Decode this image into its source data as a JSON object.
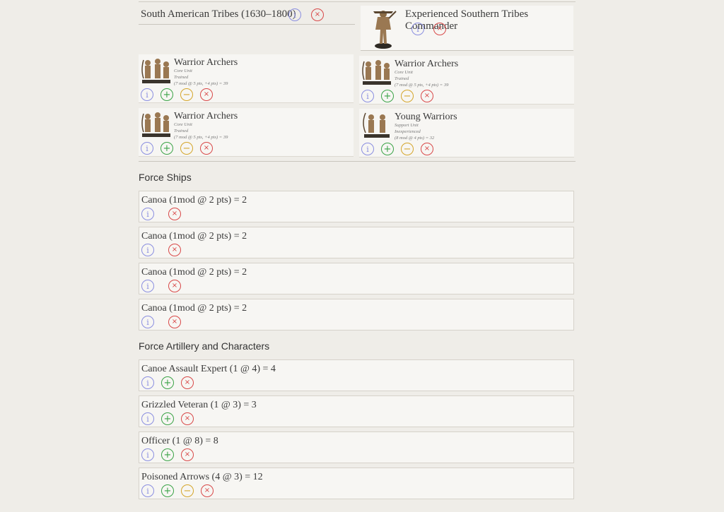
{
  "icons": {
    "info": "i",
    "add": "+",
    "remove": "−",
    "delete": "×"
  },
  "force": {
    "tribe_label": "South American Tribes (1630–1800)",
    "commander": "Experienced Southern Tribes Commander"
  },
  "units": [
    {
      "name": "Warrior Archers",
      "type": "Core Unit",
      "quality": "Trained",
      "cost": "(7 mod @ 5 pts, +4 pts) = 39"
    },
    {
      "name": "Warrior Archers",
      "type": "Core Unit",
      "quality": "Trained",
      "cost": "(7 mod @ 5 pts, +4 pts) = 39"
    },
    {
      "name": "Warrior Archers",
      "type": "Core Unit",
      "quality": "Trained",
      "cost": "(7 mod @ 5 pts, +4 pts) = 39"
    },
    {
      "name": "Young Warriors",
      "type": "Support Unit",
      "quality": "Inexperienced",
      "cost": "(8 mod @ 4 pts) = 32"
    }
  ],
  "ships": {
    "title": "Force Ships",
    "items": [
      "Canoa (1mod @ 2 pts) = 2",
      "Canoa (1mod @ 2 pts) = 2",
      "Canoa (1mod @ 2 pts) = 2",
      "Canoa (1mod @ 2 pts) = 2"
    ]
  },
  "artillery": {
    "title": "Force Artillery and Characters",
    "items": [
      "Canoe Assault Expert (1 @ 4) = 4",
      "Grizzled Veteran (1 @ 3) = 3",
      "Officer (1 @ 8) = 8",
      "Poisoned Arrows (4 @ 3) = 12"
    ]
  },
  "colors": {
    "background": "#efede8",
    "card": "#f7f6f3",
    "info": "#8a8ee0",
    "add": "#3aa346",
    "remove": "#d4a52a",
    "delete": "#d84848"
  }
}
